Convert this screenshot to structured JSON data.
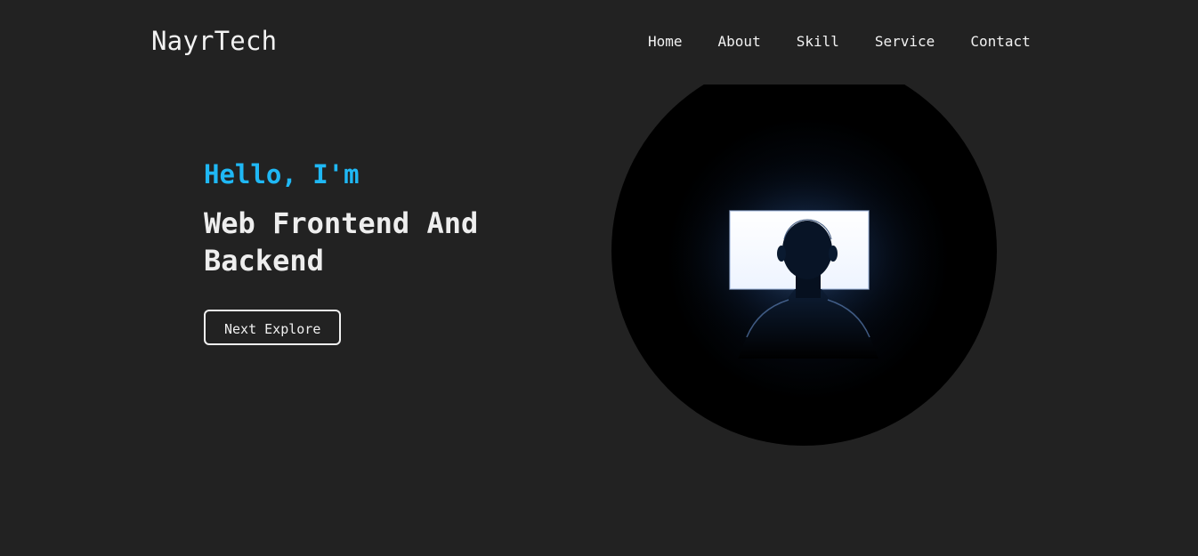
{
  "header": {
    "brand": "NayrTech",
    "nav": [
      {
        "label": "Home"
      },
      {
        "label": "About"
      },
      {
        "label": "Skill"
      },
      {
        "label": "Service"
      },
      {
        "label": "Contact"
      }
    ]
  },
  "hero": {
    "greeting": "Hello, I'm",
    "headline": "Web Frontend And Backend",
    "cta_label": "Next Explore",
    "accent_color": "#1fb8f5",
    "background_color": "#222222"
  }
}
